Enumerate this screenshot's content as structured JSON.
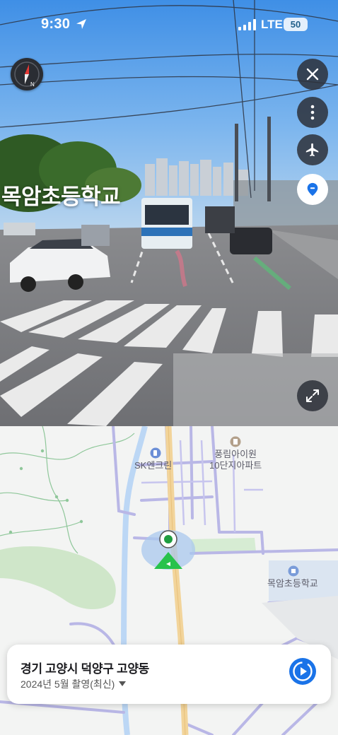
{
  "status_bar": {
    "time": "9:30",
    "network": "LTE",
    "battery": "50"
  },
  "street_view": {
    "place_label": "목암초등학교",
    "icons": {
      "compass": "compass-icon",
      "close": "close-icon",
      "more": "more-vertical-icon",
      "plane": "airplane-icon",
      "pin": "location-pin-icon",
      "expand": "expand-icon"
    }
  },
  "map": {
    "labels": {
      "gas_station": "SK엔크린",
      "apartment_line1": "풍림아이원",
      "apartment_line2": "10단지아파트",
      "school": "목암초등학교"
    }
  },
  "info_card": {
    "address": "경기 고양시 덕양구 고양동",
    "capture_date": "2024년 5월 촬영(최신)",
    "play_icon": "play-icon",
    "caret_icon": "caret-down-icon"
  },
  "colors": {
    "accent_blue": "#1a73e8",
    "road_purple": "#b9b7e6",
    "park_green": "#cfe6c9",
    "viewpoint_green": "#27c24c"
  }
}
